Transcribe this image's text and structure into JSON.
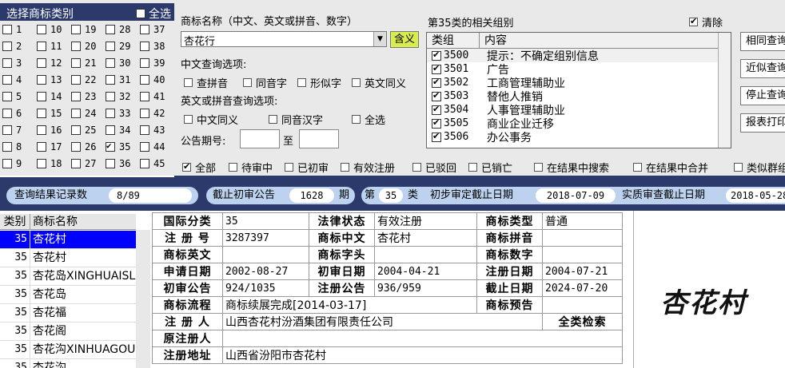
{
  "left_panel": {
    "title": "选择商标类别",
    "all_label": "全选",
    "classes": [
      "1",
      "2",
      "3",
      "4",
      "5",
      "6",
      "7",
      "8",
      "9",
      "10",
      "11",
      "12",
      "13",
      "14",
      "15",
      "16",
      "17",
      "18",
      "19",
      "20",
      "21",
      "22",
      "23",
      "24",
      "25",
      "26",
      "27",
      "28",
      "29",
      "30",
      "31",
      "32",
      "33",
      "34",
      "35",
      "36",
      "37",
      "38",
      "39",
      "40",
      "41",
      "42",
      "43",
      "44",
      "45"
    ],
    "checked_class": "35"
  },
  "search": {
    "name_label": "商标名称（中文、英文或拼音、数字）",
    "name_value": "杏花行",
    "hanyi_button": "含义",
    "cn_options_label": "中文查询选项:",
    "cn_options": [
      "查拼音",
      "同音字",
      "形似字",
      "英文同义"
    ],
    "en_options_label": "英文或拼音查询选项:",
    "en_options": [
      "中文同义",
      "同音汉字",
      "全选"
    ],
    "gazette_label": "公告期号:",
    "gazette_to": "至"
  },
  "groups": {
    "title": "第35类的相关组别",
    "clear_label": "清除",
    "col_group": "类组",
    "col_content": "内容",
    "rows": [
      {
        "code": "3500",
        "text": "提示：不确定组别信息"
      },
      {
        "code": "3501",
        "text": "广告"
      },
      {
        "code": "3502",
        "text": "工商管理辅助业"
      },
      {
        "code": "3503",
        "text": "替他人推销"
      },
      {
        "code": "3504",
        "text": "人事管理辅助业"
      },
      {
        "code": "3505",
        "text": "商业企业迁移"
      },
      {
        "code": "3506",
        "text": "办公事务"
      }
    ]
  },
  "buttons": [
    "相同查询",
    "近似查询",
    "停止查询",
    "报表打印"
  ],
  "filters": [
    "全部",
    "待审中",
    "已初审",
    "有效注册",
    "已驳回",
    "已销亡",
    "在结果中搜索",
    "在结果中合并",
    "类似群组"
  ],
  "status_bar": {
    "records_label": "查询结果记录数",
    "records_value": "8/89",
    "cutoff_label": "截止初审公告",
    "cutoff_value": "1628",
    "cutoff_unit": "期",
    "class_prefix": "第",
    "class_value": "35",
    "class_suffix": "类",
    "prelim_label": "初步审定截止日期",
    "prelim_value": "2018-07-09",
    "substantive_label": "实质审查截止日期",
    "substantive_value": "2018-05-28"
  },
  "result_list": {
    "col_class": "类别",
    "col_name": "商标名称",
    "rows": [
      {
        "cls": "35",
        "name": "杏花村"
      },
      {
        "cls": "35",
        "name": "杏花村"
      },
      {
        "cls": "35",
        "name": "杏花岛XINGHUAISLAND"
      },
      {
        "cls": "35",
        "name": "杏花岛"
      },
      {
        "cls": "35",
        "name": "杏花福"
      },
      {
        "cls": "35",
        "name": "杏花阁"
      },
      {
        "cls": "35",
        "name": "杏花沟XINHUAGOU"
      },
      {
        "cls": "35",
        "name": "杏花沟"
      }
    ]
  },
  "detail": {
    "intl_class_k": "国际分类",
    "intl_class_v": "35",
    "legal_status_k": "法律状态",
    "legal_status_v": "有效注册",
    "type_k": "商标类型",
    "type_v": "普通",
    "reg_no_k": "注 册 号",
    "reg_no_v": "3287397",
    "cn_k": "商标中文",
    "cn_v": "杏花村",
    "pinyin_k": "商标拼音",
    "pinyin_v": "",
    "en_k": "商标英文",
    "en_v": "",
    "letter_k": "商标字头",
    "letter_v": "",
    "digit_k": "商标数字",
    "digit_v": "",
    "apply_date_k": "申请日期",
    "apply_date_v": "2002-08-27",
    "prelim_date_k": "初审日期",
    "prelim_date_v": "2004-04-21",
    "reg_date_k": "注册日期",
    "reg_date_v": "2004-07-21",
    "prelim_pub_k": "初审公告",
    "prelim_pub_v": "924/1035",
    "reg_pub_k": "注册公告",
    "reg_pub_v": "936/959",
    "expiry_k": "截止日期",
    "expiry_v": "2024-07-20",
    "flow_k": "商标流程",
    "flow_v": "商标续展完成[2014-03-17]",
    "preview_k": "商标预告",
    "preview_v": "",
    "registrant_k": "注 册 人",
    "registrant_v": "山西杏花村汾酒集团有限责任公司",
    "all_class_search": "全类检索",
    "orig_registrant_k": "原注册人",
    "orig_registrant_v": "",
    "address_k": "注册地址",
    "address_v": "山西省汾阳市杏花村"
  },
  "trademark_image_text": "杏花村"
}
